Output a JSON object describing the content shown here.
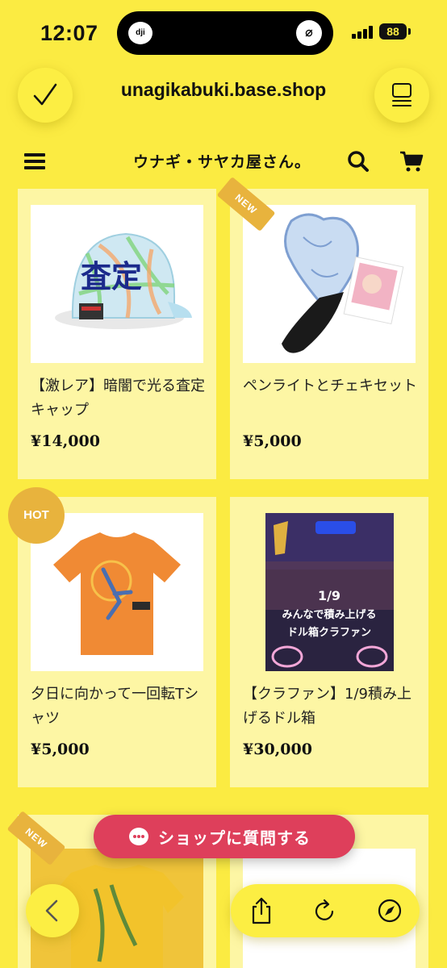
{
  "status_bar": {
    "time": "12:07",
    "island_left_label": "dji",
    "battery": "88"
  },
  "browser": {
    "url": "unagikabuki.base.shop",
    "confirm_icon": "checkmark-icon",
    "tabs_icon": "tabs-icon"
  },
  "shop": {
    "title": "ウナギ・サヤカ屋さん。",
    "menu_icon": "hamburger-icon",
    "search_icon": "search-icon",
    "cart_icon": "cart-icon"
  },
  "products": [
    {
      "name": "【激レア】暗闇で光る査定キャップ",
      "price": "¥14,000",
      "badge": ""
    },
    {
      "name": "ペンライトとチェキセット",
      "price": "¥5,000",
      "badge": "NEW"
    },
    {
      "name": "夕日に向かって一回転Tシャツ",
      "price": "¥5,000",
      "badge": "HOT"
    },
    {
      "name": "【クラファン】1/9積み上げるドル箱",
      "price": "¥30,000",
      "badge": ""
    },
    {
      "name": "",
      "price": "",
      "badge": "NEW"
    },
    {
      "name": "",
      "price": "",
      "badge": ""
    }
  ],
  "thumb_text": {
    "cap_text": "査定",
    "poster_line1": "1/9",
    "poster_line2": "みんなで積み上げる",
    "poster_line3": "ドル箱クラファン"
  },
  "chat_button": {
    "label": "ショップに質問する"
  },
  "colors": {
    "background": "#fbeb42",
    "card": "#fdf6a4",
    "badge": "#e8b33d",
    "chat": "#de3f5b"
  }
}
